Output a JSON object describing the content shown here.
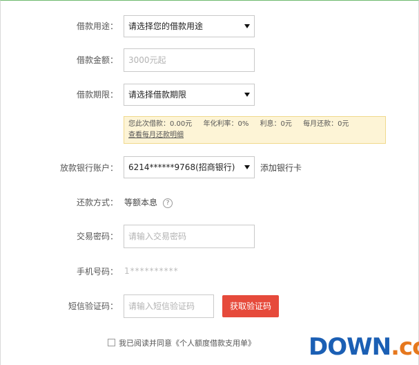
{
  "form": {
    "purpose": {
      "label": "借款用途：",
      "value": "请选择您的借款用途"
    },
    "amount": {
      "label": "借款金额：",
      "placeholder": "3000元起"
    },
    "term": {
      "label": "借款期限：",
      "value": "请选择借款期限"
    },
    "summary": {
      "loan": "您此次借款：0.00元",
      "rate": "年化利率：0%",
      "interest": "利息：0元",
      "monthly": "每月还款：0元",
      "detail_link": "查看每月还款明细"
    },
    "bank_account": {
      "label": "放款银行账户：",
      "value": "6214******9768(招商银行)",
      "add_link": "添加银行卡"
    },
    "repay_method": {
      "label": "还款方式：",
      "value": "等额本息",
      "help_icon": "question-circle-icon"
    },
    "trade_password": {
      "label": "交易密码：",
      "placeholder": "请输入交易密码"
    },
    "phone": {
      "label": "手机号码：",
      "value": "1**********"
    },
    "sms_code": {
      "label": "短信验证码：",
      "placeholder": "请输入短信验证码",
      "button": "获取验证码"
    },
    "agreement": {
      "text": "我已阅读并同意《个人额度借款支用单》"
    }
  },
  "watermark": {
    "part1": "DOWN",
    "part2": ".cc"
  },
  "colors": {
    "primary_button": "#e64a3b",
    "info_bg": "#fdf4d6",
    "top_border": "#6cb86c"
  }
}
